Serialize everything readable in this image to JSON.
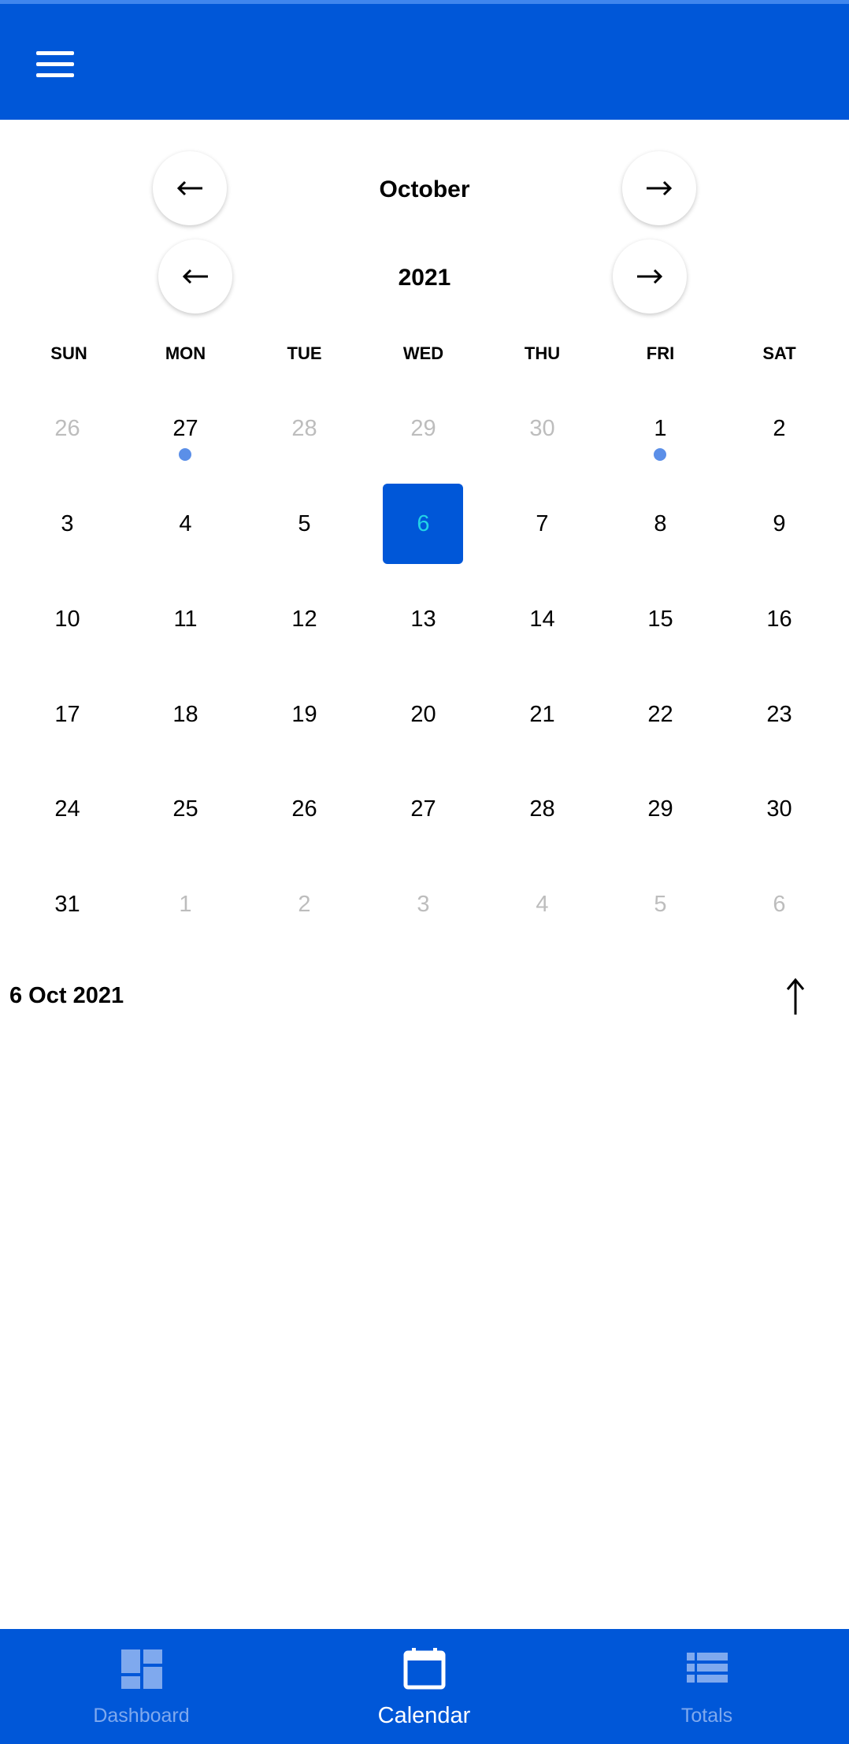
{
  "header": {
    "menu_icon": "menu-icon"
  },
  "month_nav": {
    "label": "October",
    "prev_icon": "arrow-left-icon",
    "next_icon": "arrow-right-icon"
  },
  "year_nav": {
    "label": "2021",
    "prev_icon": "arrow-left-icon",
    "next_icon": "arrow-right-icon"
  },
  "weekdays": [
    "SUN",
    "MON",
    "TUE",
    "WED",
    "THU",
    "FRI",
    "SAT"
  ],
  "weeks": [
    [
      "26",
      "27",
      "28",
      "29",
      "30",
      "1",
      "2"
    ],
    [
      "3",
      "4",
      "5",
      "6",
      "7",
      "8",
      "9"
    ],
    [
      "10",
      "11",
      "12",
      "13",
      "14",
      "15",
      "16"
    ],
    [
      "17",
      "18",
      "19",
      "20",
      "21",
      "22",
      "23"
    ],
    [
      "24",
      "25",
      "26",
      "27",
      "28",
      "29",
      "30"
    ],
    [
      "31",
      "1",
      "2",
      "3",
      "4",
      "5",
      "6"
    ]
  ],
  "selected_day": "6",
  "selected_date_label": "6 Oct 2021",
  "scroll_icon": "arrow-up-icon",
  "colors": {
    "primary": "#0057d8",
    "dot": "#5b8fe8",
    "selected_text": "#22d3e6",
    "dim": "#bdbdbd"
  },
  "tabs": [
    {
      "label": "Dashboard",
      "icon": "dashboard-icon",
      "active": false
    },
    {
      "label": "Calendar",
      "icon": "calendar-icon",
      "active": true
    },
    {
      "label": "Totals",
      "icon": "list-icon",
      "active": false
    }
  ]
}
